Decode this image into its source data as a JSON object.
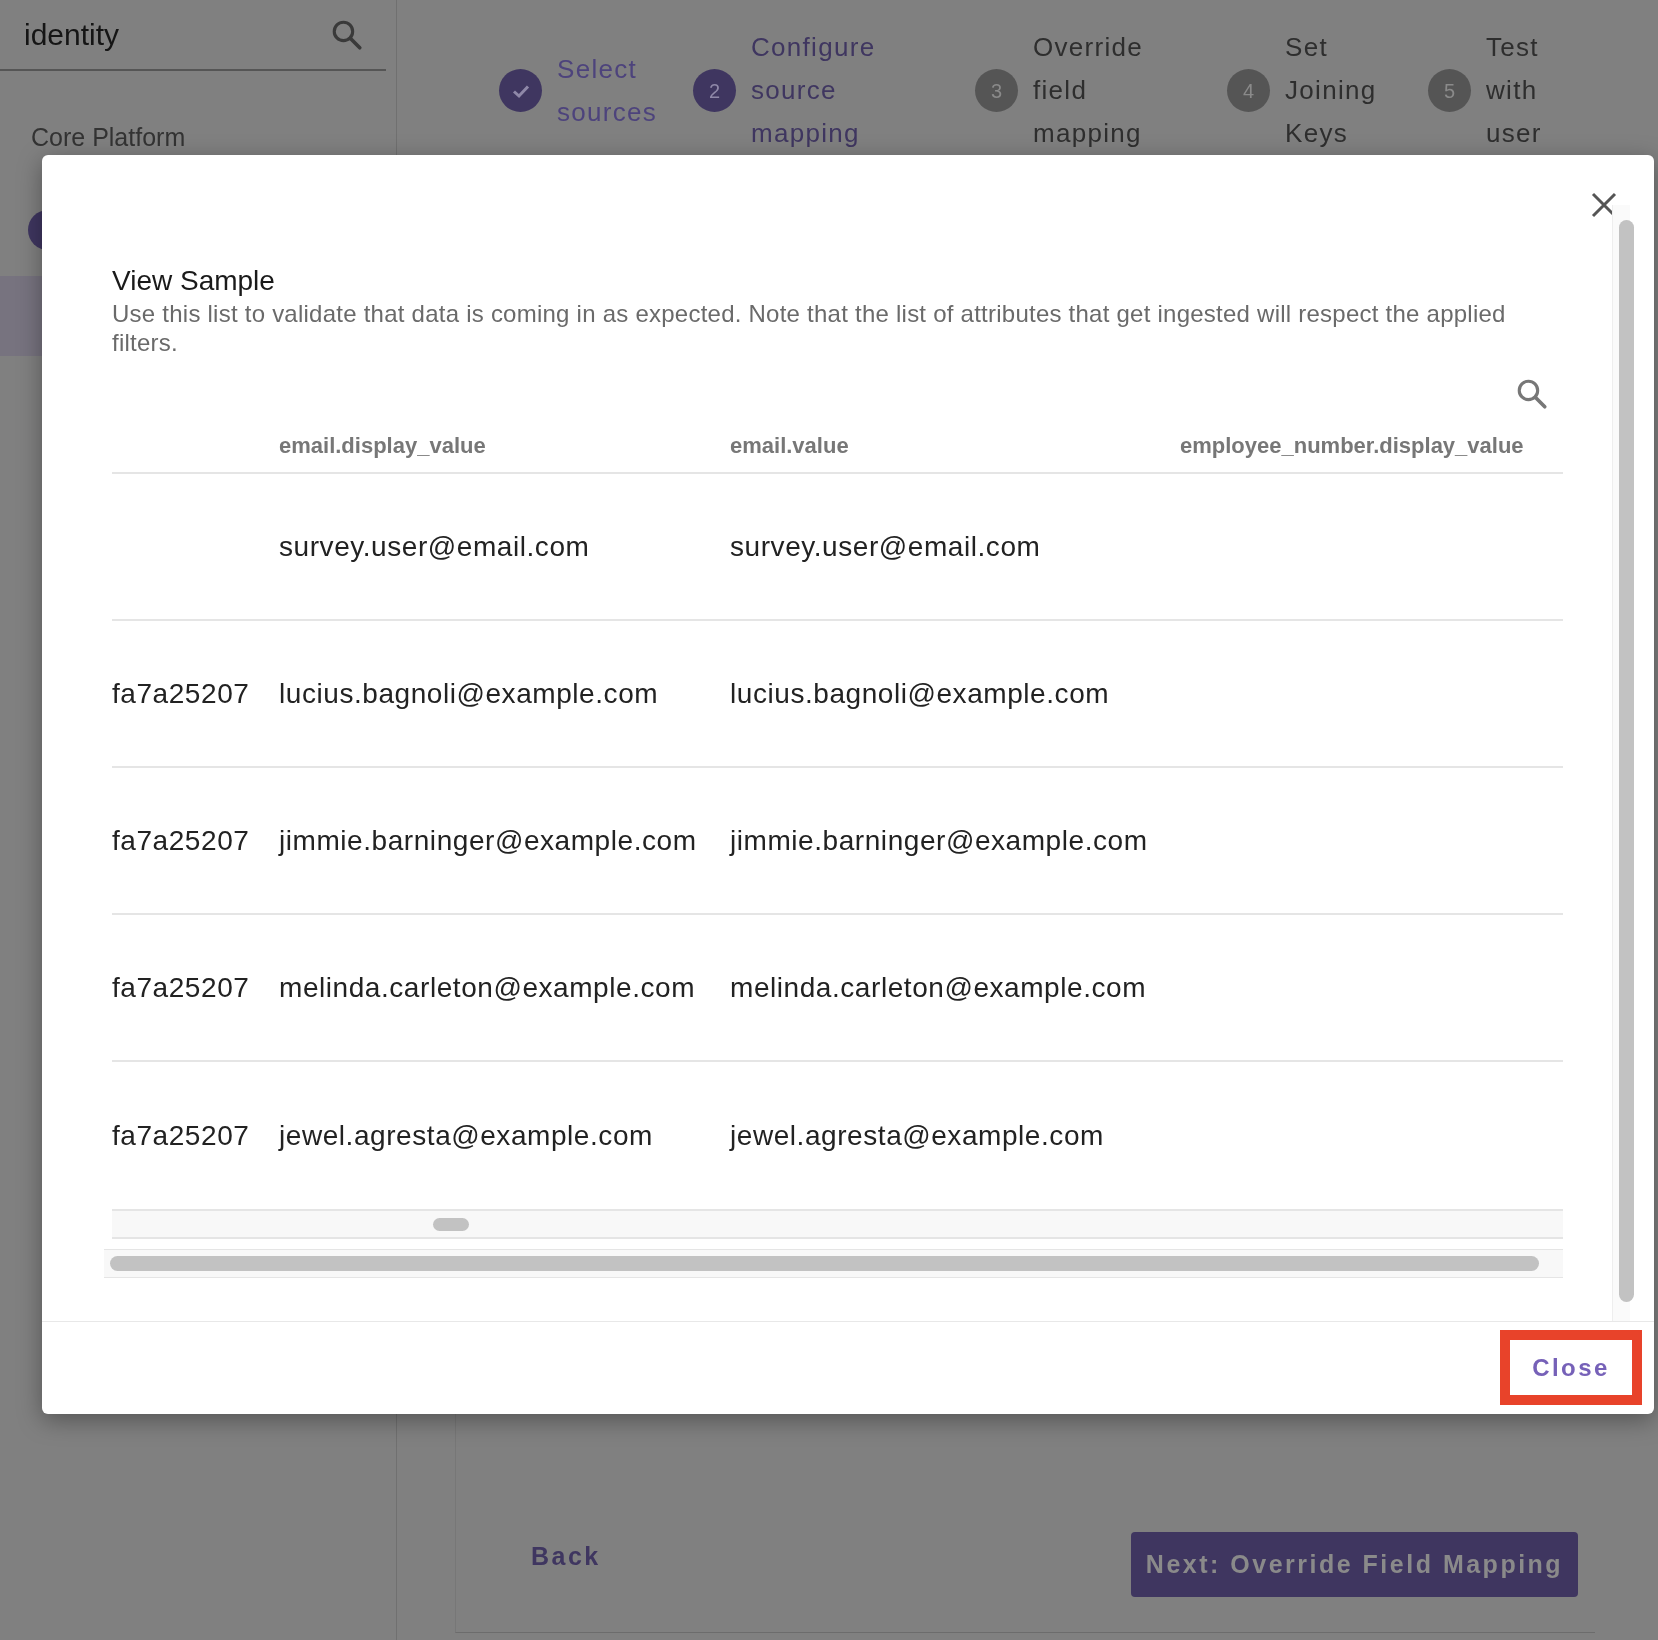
{
  "sidebar": {
    "search": {
      "value": "identity"
    },
    "section": "Core Platform"
  },
  "stepper": [
    {
      "label": "Select sources",
      "completed": true,
      "selected": false
    },
    {
      "label": "Configure source mapping",
      "number": "2",
      "completed": false,
      "selected": true
    },
    {
      "label": "Override field mapping",
      "number": "3",
      "completed": false,
      "selected": false
    },
    {
      "label": "Set Joining Keys",
      "number": "4",
      "completed": false,
      "selected": false
    },
    {
      "label": "Test with user",
      "number": "5",
      "completed": false,
      "selected": false
    }
  ],
  "modal": {
    "title": "View Sample",
    "description": "Use this list to validate that data is coming in as expected. Note that the list of attributes that get ingested will respect the applied filters.",
    "table": {
      "headers": {
        "column_2": "email.display_value",
        "column_3": "email.value",
        "column_4": "employee_number.display_value"
      },
      "rows": [
        {
          "column_2": "survey.user@email.com",
          "column_3": "survey.user@email.com"
        },
        {
          "column_1": "fa7a25207",
          "column_2": "lucius.bagnoli@example.com",
          "column_3": "lucius.bagnoli@example.com"
        },
        {
          "column_1": "fa7a25207",
          "column_2": "jimmie.barninger@example.com",
          "column_3": "jimmie.barninger@example.com"
        },
        {
          "column_1": "fa7a25207",
          "column_2": "melinda.carleton@example.com",
          "column_3": "melinda.carleton@example.com"
        },
        {
          "column_1": "fa7a25207",
          "column_2": "jewel.agresta@example.com",
          "column_3": "jewel.agresta@example.com"
        }
      ]
    },
    "close_button": {
      "label": "Close",
      "highlighted": true
    }
  },
  "footer": {
    "back": "Back",
    "next": "Next: Override Field Mapping"
  }
}
